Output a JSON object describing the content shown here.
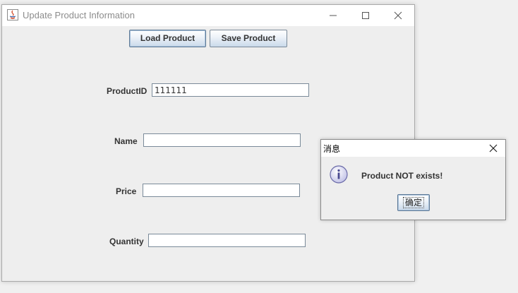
{
  "window": {
    "title": "Update Product Information"
  },
  "toolbar": {
    "load_label": "Load Product",
    "save_label": "Save Product"
  },
  "form": {
    "product_id": {
      "label": "ProductID",
      "value": "111111"
    },
    "name": {
      "label": "Name",
      "value": ""
    },
    "price": {
      "label": "Price",
      "value": ""
    },
    "quantity": {
      "label": "Quantity",
      "value": ""
    }
  },
  "dialog": {
    "title": "消息",
    "message": "Product NOT exists!",
    "ok_label": "确定",
    "icon": "info-icon"
  },
  "colors": {
    "button_gradient_bottom": "#c9d9ea",
    "info_icon_fill": "#d8d8f0",
    "info_icon_stroke": "#6a6aa8"
  }
}
